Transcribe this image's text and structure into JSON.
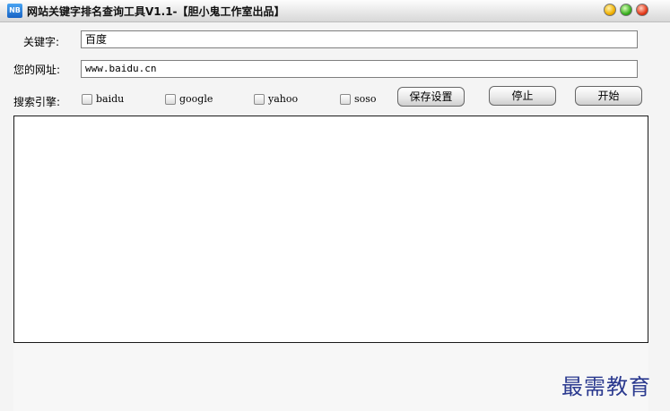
{
  "window": {
    "title": "网站关键字排名查询工具V1.1-【胆小鬼工作室出品】",
    "icon_text": "NB"
  },
  "form": {
    "keyword_label": "关键字:",
    "keyword_value": "百度",
    "url_label": "您的网址:",
    "url_value": "www.baidu.cn",
    "engine_label": "搜索引擎:",
    "engines": [
      {
        "label": "baidu",
        "checked": false
      },
      {
        "label": "google",
        "checked": false
      },
      {
        "label": "yahoo",
        "checked": false
      },
      {
        "label": "soso",
        "checked": false
      }
    ]
  },
  "buttons": {
    "save": "保存设置",
    "stop": "停止",
    "start": "开始"
  },
  "watermark": "最需教育"
}
